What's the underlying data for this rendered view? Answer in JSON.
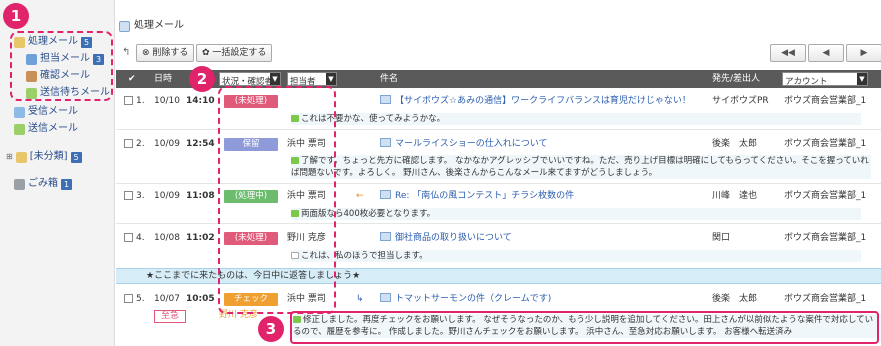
{
  "sidebar": {
    "items": [
      {
        "label": "処理メール",
        "count": "5"
      },
      {
        "label": "担当メール",
        "count": "3"
      },
      {
        "label": "確認メール",
        "count": ""
      },
      {
        "label": "送信待ちメール",
        "count": ""
      },
      {
        "label": "受信メール",
        "count": ""
      },
      {
        "label": "送信メール",
        "count": ""
      },
      {
        "label": "[未分類]",
        "count": "5"
      },
      {
        "label": "ごみ箱",
        "count": "1"
      }
    ]
  },
  "main": {
    "title": "処理メール",
    "toolbar": {
      "delete_label": "削除する",
      "bulk_label": "一括設定する"
    },
    "pager": {
      "first": "◀◀",
      "prev": "◀",
      "next": "▶"
    },
    "header": {
      "check": "✔",
      "date": "日時",
      "status": "状況・確認者",
      "assignee": "担当者",
      "subject": "件名",
      "sender": "発先/差出人",
      "account": "アカウント"
    },
    "rows": [
      {
        "num": "1.",
        "date": "10/10",
        "time": "14:10",
        "status": "(未処理)",
        "status_color": "#e05a7a",
        "assignee": "",
        "subject": "【サイボウズ☆あみの通信】ワークライフバランスは育児だけじゃない！",
        "sender": "サイボウズPR",
        "account": "ボウズ商会営業部_1",
        "comment": "これは不要かな、使ってみようかな。"
      },
      {
        "num": "2.",
        "date": "10/09",
        "time": "12:54",
        "status": "保留",
        "status_color": "#8f9ad9",
        "assignee": "浜中 票司",
        "subject": "マールライスショーの仕入れについて",
        "sender": "後楽　太郎",
        "account": "ボウズ商会営業部_1",
        "comment": "了解です。ちょっと先方に確認します。 なかなかアグレッシブでいいですね。ただ、売り上げ目標は明確にしてもらってください。そこを握っていれば問題ないです。よろしく。 野川さん、後楽さんからこんなメール来てますがどうしましょう。"
      },
      {
        "num": "3.",
        "date": "10/09",
        "time": "11:08",
        "status": "(処理中)",
        "status_color": "#6cbc6e",
        "assignee": "浜中 票司",
        "subject": "Re: 「南仏の風コンテスト」チラシ枚数の件",
        "sender": "川峰　達也",
        "account": "ボウズ商会営業部_1",
        "comment": "両面版なら400枚必要となります。"
      },
      {
        "num": "4.",
        "date": "10/08",
        "time": "11:02",
        "status": "(未処理)",
        "status_color": "#e05a7a",
        "assignee": "野川 克彦",
        "subject": "御社商品の取り扱いについて",
        "sender": "関口",
        "account": "ボウズ商会営業部_1",
        "comment": "これは、私のほうで担当します。"
      },
      {
        "num": "5.",
        "date": "10/07",
        "time": "10:05",
        "status": "チェック",
        "status_color": "#f0a030",
        "assignee": "浜中 票司",
        "subject": "トマットサーモンの件（クレームです)",
        "sender": "後楽　太郎",
        "account": "ボウズ商会営業部_1",
        "comment": "",
        "tag": "至急",
        "checker": "野川 克彦"
      }
    ],
    "banner": "★ここまでに来たものは、今日中に返答しましょう★",
    "row5_comment": "修正しました。再度チェックをお願いします。 なぜそうなったのか、もう少し説明を追加してください。田上さんが以前似たような案件で対応しているので、履歴を参考に。 作成しました。野川さんチェックをお願いします。 浜中さん、至急対応お願いします。 お客様へ転送済み"
  },
  "annotations": [
    "1",
    "2",
    "3"
  ],
  "colors": {
    "accent": "#e0236a",
    "header_bg": "#5a5a5a",
    "link": "#2a5db0"
  }
}
